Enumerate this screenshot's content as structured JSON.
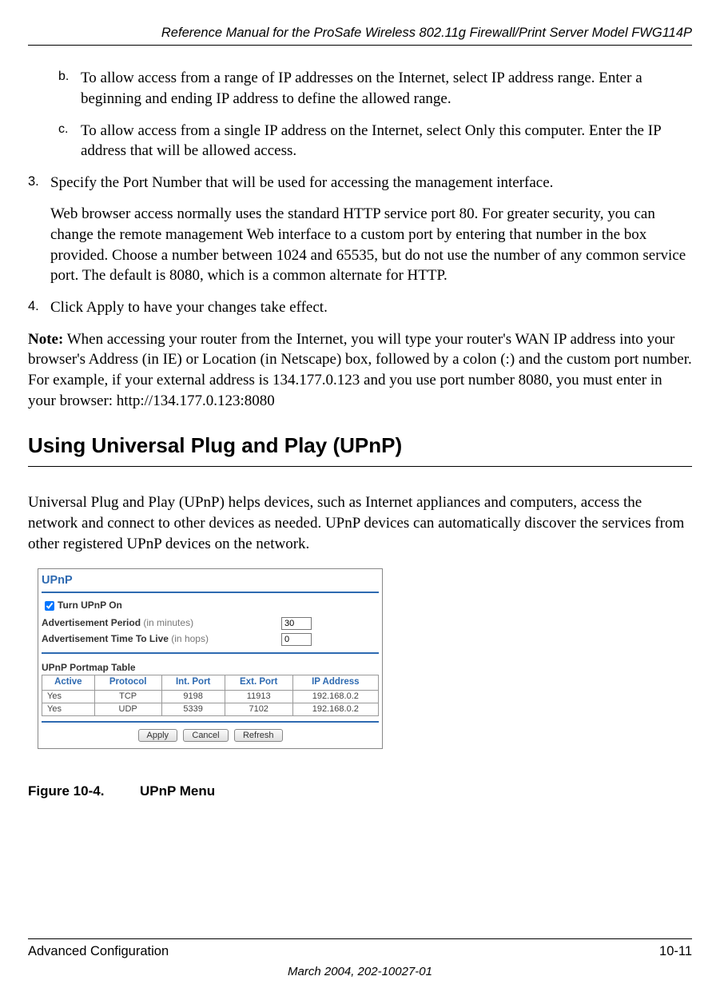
{
  "header": {
    "title": "Reference Manual for the ProSafe Wireless 802.11g  Firewall/Print Server Model FWG114P"
  },
  "list": {
    "item_b": {
      "marker": "b.",
      "text": "To allow access from a range of IP addresses on the Internet, select IP address range. Enter a beginning and ending IP address to define the allowed range."
    },
    "item_c": {
      "marker": "c.",
      "text": "To allow access from a single IP address on the Internet, select Only this computer. Enter the IP address that will be allowed access."
    },
    "item_3": {
      "marker": "3.",
      "text": "Specify the Port Number that will be used for accessing the management interface.",
      "sub": "Web browser access normally uses the standard HTTP service port 80. For greater security, you can change the remote management Web interface to a custom port by entering that number in the box provided. Choose a number between 1024 and 65535, but do not use the number of any common service port. The default is 8080, which is a common alternate for HTTP."
    },
    "item_4": {
      "marker": "4.",
      "text": "Click Apply to have your changes take effect."
    }
  },
  "note": {
    "label": "Note:",
    "text": " When accessing your router from the Internet, you will type your router's WAN IP address into your browser's Address (in IE) or Location (in Netscape) box, followed by a colon (:) and the custom port number. For example, if your external address is 134.177.0.123 and you use port number 8080, you must enter in your browser: http://134.177.0.123:8080"
  },
  "section": {
    "heading": "Using Universal Plug and Play (UPnP)",
    "intro": "Universal Plug and Play (UPnP) helps devices, such as Internet appliances and computers, access the network and connect to other devices as needed. UPnP devices can automatically discover the services from other registered UPnP devices on the network."
  },
  "upnp": {
    "title": "UPnP",
    "turn_on_label": "Turn UPnP On",
    "adv_period_label_bold": "Advertisement Period",
    "adv_period_label_gray": " (in minutes)",
    "adv_period_value": "30",
    "adv_ttl_label_bold": "Advertisement Time To Live",
    "adv_ttl_label_gray": " (in hops)",
    "adv_ttl_value": "0",
    "portmap_title": "UPnP Portmap Table",
    "columns": {
      "active": "Active",
      "protocol": "Protocol",
      "int_port": "Int. Port",
      "ext_port": "Ext. Port",
      "ip": "IP Address"
    },
    "rows": [
      {
        "active": "Yes",
        "protocol": "TCP",
        "int_port": "9198",
        "ext_port": "11913",
        "ip": "192.168.0.2"
      },
      {
        "active": "Yes",
        "protocol": "UDP",
        "int_port": "5339",
        "ext_port": "7102",
        "ip": "192.168.0.2"
      }
    ],
    "buttons": {
      "apply": "Apply",
      "cancel": "Cancel",
      "refresh": "Refresh"
    }
  },
  "figure": {
    "number": "Figure 10-4.",
    "caption": "UPnP Menu"
  },
  "footer": {
    "left": "Advanced Configuration",
    "right": "10-11",
    "date": "March 2004, 202-10027-01"
  }
}
